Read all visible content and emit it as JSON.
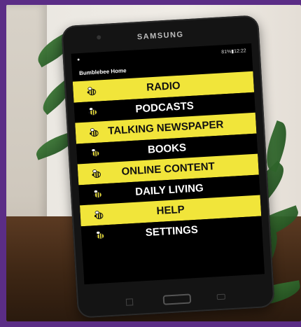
{
  "tablet": {
    "brand": "SAMSUNG",
    "status_time": "81%▮12:22",
    "app_title": "Bumblebee Home"
  },
  "menu": [
    {
      "label": "RADIO",
      "style": "yellow"
    },
    {
      "label": "PODCASTS",
      "style": "dark"
    },
    {
      "label": "TALKING NEWSPAPER",
      "style": "yellow"
    },
    {
      "label": "BOOKS",
      "style": "dark"
    },
    {
      "label": "ONLINE CONTENT",
      "style": "yellow"
    },
    {
      "label": "DAILY LIVING",
      "style": "dark"
    },
    {
      "label": "HELP",
      "style": "yellow"
    },
    {
      "label": "SETTINGS",
      "style": "dark"
    }
  ],
  "icons": {
    "menu_item_icon": "bee-icon"
  },
  "colors": {
    "frame": "#5b2d86",
    "highlight": "#f1e53a",
    "screen": "#000000"
  }
}
